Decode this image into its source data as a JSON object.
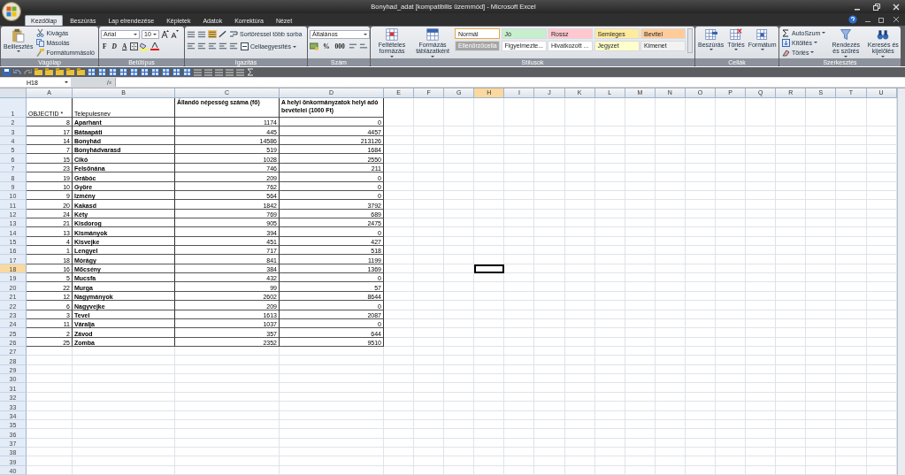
{
  "window": {
    "title": "Bonyhad_adat  [kompatibilis üzemmód] - Microsoft Excel"
  },
  "tabs": [
    {
      "label": "Kezdőlap",
      "selected": true
    },
    {
      "label": "Beszúrás",
      "selected": false
    },
    {
      "label": "Lap elrendezése",
      "selected": false
    },
    {
      "label": "Képletek",
      "selected": false
    },
    {
      "label": "Adatok",
      "selected": false
    },
    {
      "label": "Korrektúra",
      "selected": false
    },
    {
      "label": "Nézet",
      "selected": false
    }
  ],
  "ribbon": [
    {
      "kind": "clipboard",
      "label": "Vágólap",
      "big": "Beillesztés",
      "small": [
        "Kivágás",
        "Másolás",
        "Formátummásoló"
      ]
    },
    {
      "kind": "font",
      "label": "Betűtípus",
      "font": "Arial",
      "size": "10",
      "keys": [
        "F",
        "D",
        "A"
      ]
    },
    {
      "kind": "alignment",
      "label": "Igazítás",
      "wrap": "Sortöréssel több sorba",
      "merge": "Cellaegyesítés"
    },
    {
      "kind": "number",
      "label": "Szám",
      "format": "Általános",
      "keys": [
        "%",
        "000"
      ]
    },
    {
      "kind": "styles",
      "label": "Stílusok",
      "big": [
        "Feltételes formázás",
        "Formázás táblázatként"
      ],
      "styles": [
        {
          "label": "Normál",
          "color": "#ffffff",
          "selected": true
        },
        {
          "label": "Jó",
          "color": "#c6efce",
          "selected": false
        },
        {
          "label": "Rossz",
          "color": "#ffc7ce",
          "selected": false
        },
        {
          "label": "Semleges",
          "color": "#ffeb9c",
          "selected": false
        },
        {
          "label": "Bevitel",
          "color": "#ffcc99",
          "selected": false
        },
        {
          "label": "Ellenőrzőcella",
          "color": "#a5a5a5",
          "selected": false
        },
        {
          "label": "Figyelmezte...",
          "color": "#ffffff",
          "selected": false
        },
        {
          "label": "Hivatkozott ...",
          "color": "#ffffff",
          "selected": false
        },
        {
          "label": "Jegyzet",
          "color": "#ffffcc",
          "selected": false
        },
        {
          "label": "Kimenet",
          "color": "#f2f2f2",
          "selected": false
        }
      ]
    },
    {
      "kind": "cells",
      "label": "Cellák",
      "big": [
        "Beszúrás",
        "Törlés",
        "Formátum"
      ]
    },
    {
      "kind": "editing",
      "label": "Szerkesztés",
      "small": [
        "AutoSzum",
        "Kitöltés",
        "Törlés"
      ],
      "big": [
        "Rendezés és szűrés",
        "Keresés és kijelölés"
      ]
    }
  ],
  "formula_bar": {
    "name_box": "H18",
    "fx": "fx"
  },
  "columns": [
    {
      "label": "A",
      "selected": false
    },
    {
      "label": "B",
      "selected": false
    },
    {
      "label": "C",
      "selected": false
    },
    {
      "label": "D",
      "selected": false
    },
    {
      "label": "E",
      "selected": false
    },
    {
      "label": "F",
      "selected": false
    },
    {
      "label": "G",
      "selected": false
    },
    {
      "label": "H",
      "selected": true
    },
    {
      "label": "I",
      "selected": false
    },
    {
      "label": "J",
      "selected": false
    },
    {
      "label": "K",
      "selected": false
    },
    {
      "label": "L",
      "selected": false
    },
    {
      "label": "M",
      "selected": false
    },
    {
      "label": "N",
      "selected": false
    },
    {
      "label": "O",
      "selected": false
    },
    {
      "label": "P",
      "selected": false
    },
    {
      "label": "Q",
      "selected": false
    },
    {
      "label": "R",
      "selected": false
    },
    {
      "label": "S",
      "selected": false
    },
    {
      "label": "T",
      "selected": false
    },
    {
      "label": "U",
      "selected": false
    }
  ],
  "row_headers": [
    {
      "label": "1",
      "selected": false
    },
    {
      "label": "2",
      "selected": false
    },
    {
      "label": "3",
      "selected": false
    },
    {
      "label": "4",
      "selected": false
    },
    {
      "label": "5",
      "selected": false
    },
    {
      "label": "6",
      "selected": false
    },
    {
      "label": "7",
      "selected": false
    },
    {
      "label": "8",
      "selected": false
    },
    {
      "label": "9",
      "selected": false
    },
    {
      "label": "10",
      "selected": false
    },
    {
      "label": "11",
      "selected": false
    },
    {
      "label": "12",
      "selected": false
    },
    {
      "label": "13",
      "selected": false
    },
    {
      "label": "14",
      "selected": false
    },
    {
      "label": "15",
      "selected": false
    },
    {
      "label": "16",
      "selected": false
    },
    {
      "label": "17",
      "selected": false
    },
    {
      "label": "18",
      "selected": true
    },
    {
      "label": "19",
      "selected": false
    },
    {
      "label": "20",
      "selected": false
    },
    {
      "label": "21",
      "selected": false
    },
    {
      "label": "22",
      "selected": false
    },
    {
      "label": "23",
      "selected": false
    },
    {
      "label": "24",
      "selected": false
    },
    {
      "label": "25",
      "selected": false
    },
    {
      "label": "26",
      "selected": false
    },
    {
      "label": "27",
      "selected": false
    },
    {
      "label": "28",
      "selected": false
    },
    {
      "label": "29",
      "selected": false
    },
    {
      "label": "30",
      "selected": false
    },
    {
      "label": "31",
      "selected": false
    },
    {
      "label": "32",
      "selected": false
    },
    {
      "label": "33",
      "selected": false
    },
    {
      "label": "34",
      "selected": false
    },
    {
      "label": "35",
      "selected": false
    },
    {
      "label": "36",
      "selected": false
    },
    {
      "label": "37",
      "selected": false
    },
    {
      "label": "38",
      "selected": false
    },
    {
      "label": "39",
      "selected": false
    },
    {
      "label": "40",
      "selected": false
    }
  ],
  "table": {
    "header": [
      "OBJECTID *",
      "Telepulesnev",
      "Állandó népesség száma (fő)",
      "A helyi önkormányzatok helyi adó bevételei (1000 Ft)"
    ],
    "rows": [
      [
        "8",
        "Aparhant",
        "1174",
        "0"
      ],
      [
        "17",
        "Bátaapáti",
        "445",
        "4457"
      ],
      [
        "14",
        "Bonyhád",
        "14586",
        "213126"
      ],
      [
        "7",
        "Bonyhádvarasd",
        "519",
        "1684"
      ],
      [
        "15",
        "Cikó",
        "1028",
        "2550"
      ],
      [
        "23",
        "Felsőnána",
        "746",
        "211"
      ],
      [
        "19",
        "Grábóc",
        "209",
        "0"
      ],
      [
        "10",
        "Györe",
        "762",
        "0"
      ],
      [
        "9",
        "Izmény",
        "564",
        "0"
      ],
      [
        "20",
        "Kakasd",
        "1842",
        "3792"
      ],
      [
        "24",
        "Kéty",
        "769",
        "689"
      ],
      [
        "21",
        "Kisdorog",
        "905",
        "2475"
      ],
      [
        "13",
        "Kismányok",
        "394",
        "0"
      ],
      [
        "4",
        "Kisvejke",
        "451",
        "427"
      ],
      [
        "1",
        "Lengyel",
        "717",
        "518"
      ],
      [
        "18",
        "Mórágy",
        "841",
        "1199"
      ],
      [
        "16",
        "Mőcsény",
        "384",
        "1369"
      ],
      [
        "5",
        "Mucsfa",
        "432",
        "0"
      ],
      [
        "22",
        "Murga",
        "99",
        "57"
      ],
      [
        "12",
        "Nagymányok",
        "2602",
        "8644"
      ],
      [
        "6",
        "Nagyvejke",
        "209",
        "0"
      ],
      [
        "3",
        "Tevel",
        "1613",
        "2087"
      ],
      [
        "11",
        "Váralja",
        "1037",
        "0"
      ],
      [
        "2",
        "Závod",
        "357",
        "644"
      ],
      [
        "25",
        "Zomba",
        "2352",
        "9510"
      ]
    ]
  }
}
